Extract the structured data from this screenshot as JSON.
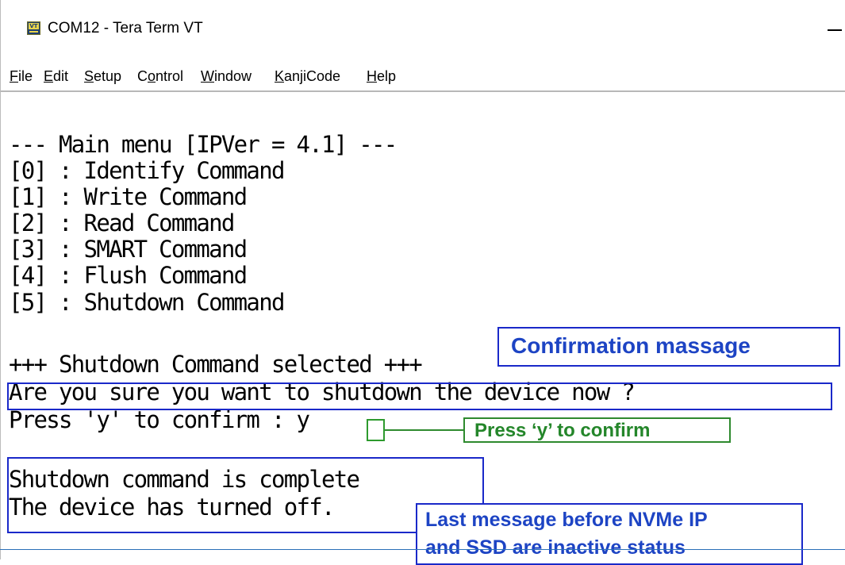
{
  "window": {
    "title": "COM12 - Tera Term VT",
    "app_icon": "VT"
  },
  "menu": {
    "items": [
      {
        "key": "F",
        "rest": "ile"
      },
      {
        "key": "E",
        "rest": "dit"
      },
      {
        "key": "S",
        "rest": "etup"
      },
      {
        "pre": "C",
        "key": "o",
        "rest": "ntrol"
      },
      {
        "key": "W",
        "rest": "indow"
      },
      {
        "key": "K",
        "rest": "anjiCode"
      },
      {
        "key": "H",
        "rest": "elp"
      }
    ]
  },
  "terminal": {
    "lines": [
      "--- Main menu [IPVer = 4.1] ---",
      "[0] : Identify Command",
      "[1] : Write Command",
      "[2] : Read Command",
      "[3] : SMART Command",
      "[4] : Flush Command",
      "[5] : Shutdown Command",
      "",
      "+++ Shutdown Command selected +++",
      "Are you sure you want to shutdown the device now ?",
      "Press 'y' to confirm : y",
      "",
      "Shutdown command is complete",
      "The device has turned off."
    ]
  },
  "annotations": {
    "confirmation": "Confirmation massage",
    "press_y": "Press ‘y’ to confirm",
    "last_message_line1": "Last message before NVMe IP",
    "last_message_line2": "and SSD are inactive status"
  },
  "colors": {
    "annotation_blue": "#1a29c9",
    "annotation_green": "#2e8a2e"
  }
}
